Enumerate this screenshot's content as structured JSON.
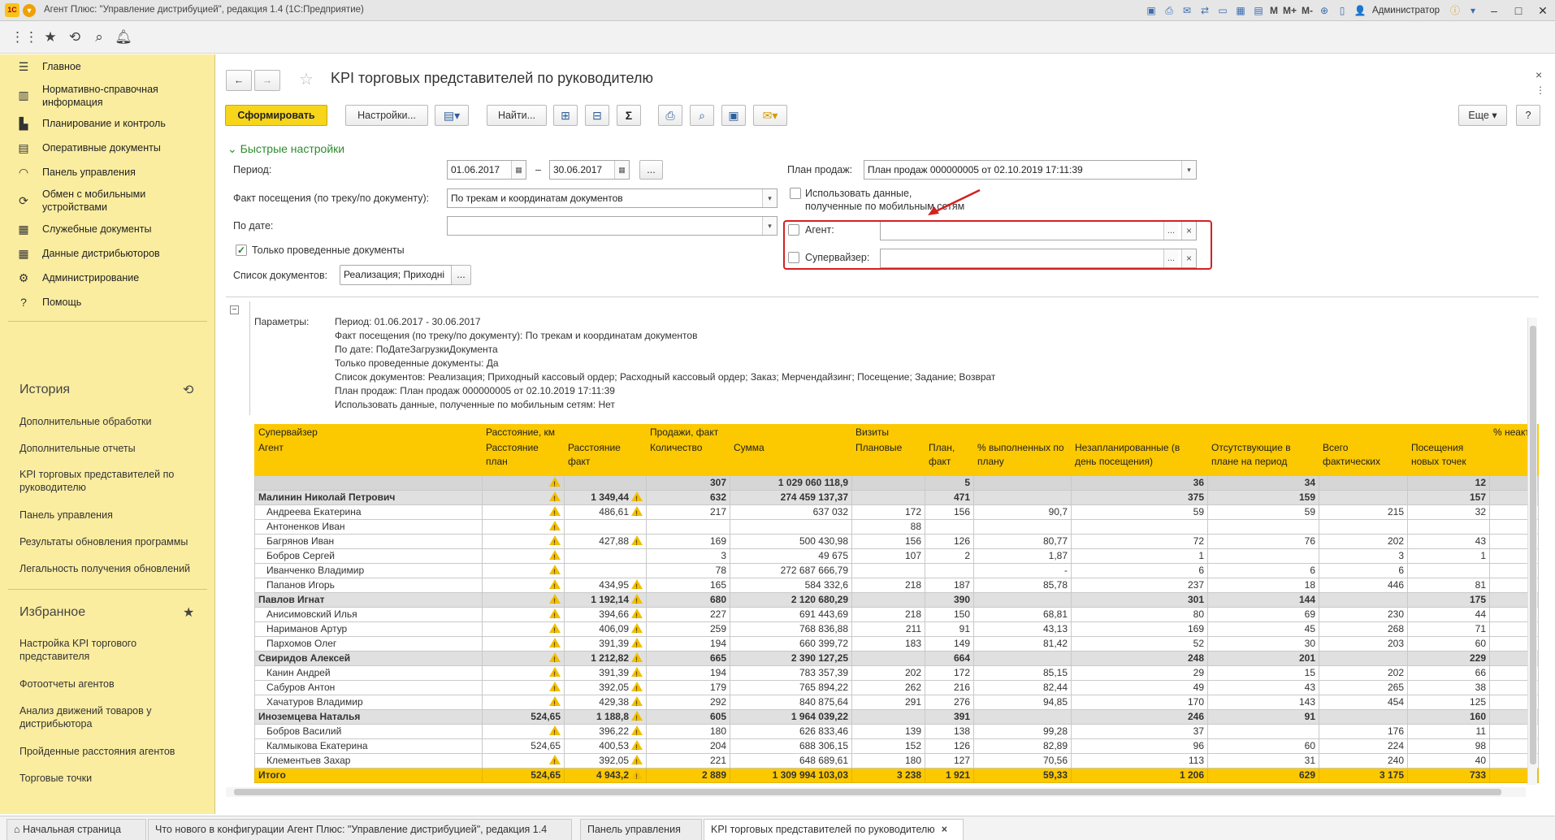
{
  "window": {
    "logo": "1С",
    "title": "Агент Плюс: \"Управление дистрибуцией\", редакция 1.4  (1С:Предприятие)",
    "user": "Администратор",
    "memory": [
      "M",
      "M+",
      "M-"
    ]
  },
  "sidebar": {
    "items": [
      {
        "label": "Главное",
        "icon": "menu-lines-icon"
      },
      {
        "label": "Нормативно-справочная информация",
        "icon": "book-icon"
      },
      {
        "label": "Планирование и контроль",
        "icon": "chart-icon"
      },
      {
        "label": "Оперативные документы",
        "icon": "documents-icon"
      },
      {
        "label": "Панель управления",
        "icon": "gauge-icon"
      },
      {
        "label": "Обмен с мобильными устройствами",
        "icon": "sync-icon"
      },
      {
        "label": "Служебные документы",
        "icon": "service-docs-icon"
      },
      {
        "label": "Данные дистрибьюторов",
        "icon": "table-icon"
      },
      {
        "label": "Администрирование",
        "icon": "gear-icon"
      },
      {
        "label": "Помощь",
        "icon": "help-icon"
      }
    ],
    "history_title": "История",
    "history": [
      "Дополнительные обработки",
      "Дополнительные отчеты",
      "KPI торговых представителей по руководителю",
      "Панель управления",
      "Результаты обновления программы",
      "Легальность получения обновлений"
    ],
    "favorites_title": "Избранное",
    "favorites": [
      "Настройка KPI торгового представителя",
      "Фотоотчеты агентов",
      "Анализ движений товаров у дистрибьютора",
      "Пройденные расстояния агентов",
      "Торговые точки"
    ]
  },
  "page": {
    "title": "KPI торговых представителей по руководителю",
    "toolbar": {
      "generate": "Сформировать",
      "settings": "Настройки...",
      "find": "Найти...",
      "sum": "Σ",
      "more": "Еще",
      "help": "?"
    },
    "quick_settings": "Быстрые настройки",
    "period_label": "Период:",
    "period_from": "01.06.2017",
    "period_dash": "–",
    "period_to": "30.06.2017",
    "fact_label": "Факт посещения (по треку/по документу):",
    "fact_value": "По трекам и координатам документов",
    "by_date_label": "По дате:",
    "by_date_value": "",
    "only_posted_label": "Только проведенные документы",
    "doc_list_label": "Список документов:",
    "doc_list_value": "Реализация; Приходні",
    "plan_label": "План продаж:",
    "plan_value": "План продаж 000000005 от 02.10.2019 17:11:39",
    "mobile_label_1": "Использовать данные,",
    "mobile_label_2": "полученные по мобильным сетям",
    "agent_label": "Агент:",
    "supervisor_label": "Супервайзер:",
    "ellipsis": "...",
    "clear": "×"
  },
  "report": {
    "params_label": "Параметры:",
    "params": [
      "Период: 01.06.2017 - 30.06.2017",
      "Факт посещения (по треку/по документу): По трекам и координатам документов",
      "По дате: ПоДатеЗагрузкиДокумента",
      "Только проведенные документы: Да",
      "Список документов: Реализация; Приходный кассовый ордер; Расходный кассовый ордер; Заказ; Мерчендайзинг; Посещение; Задание; Возврат",
      "План продаж: План продаж 000000005 от 02.10.2019 17:11:39",
      "Использовать данные, полученные по мобильным сетям: Нет"
    ],
    "header1": [
      "Супервайзер",
      "Расстояние, км",
      "Продажи, факт",
      "Визиты",
      "% неакт"
    ],
    "header2": [
      "Агент",
      "Расстояние план",
      "Расстояние факт",
      "Количество",
      "Сумма",
      "Плановые",
      "План, факт",
      "% выполненных по плану",
      "Незапланированные (в день посещения)",
      "Отсутствующие в плане на период",
      "Всего фактических",
      "Посещения новых точек",
      ""
    ],
    "rows": [
      {
        "kind": "gtop",
        "cells": [
          "",
          "",
          "",
          "307",
          "1 029 060 118,9",
          "",
          "5",
          "",
          "36",
          "34",
          "",
          "12",
          ""
        ],
        "warn": [
          1
        ]
      },
      {
        "kind": "grp",
        "cells": [
          "Малинин Николай Петрович",
          "",
          "1 349,44",
          "632",
          "274 459 137,37",
          "",
          "471",
          "",
          "375",
          "159",
          "",
          "157",
          ""
        ],
        "warn": [
          1,
          2
        ]
      },
      {
        "kind": "row",
        "cells": [
          "Андреева Екатерина",
          "",
          "486,61",
          "217",
          "637 032",
          "172",
          "156",
          "90,7",
          "59",
          "59",
          "215",
          "32",
          ""
        ],
        "warn": [
          1,
          2
        ]
      },
      {
        "kind": "row",
        "cells": [
          "Антоненков Иван",
          "",
          "",
          "",
          "",
          "88",
          "",
          "",
          "",
          "",
          "",
          "",
          ""
        ],
        "warn": [
          1
        ]
      },
      {
        "kind": "row",
        "cells": [
          "Багрянов Иван",
          "",
          "427,88",
          "169",
          "500 430,98",
          "156",
          "126",
          "80,77",
          "72",
          "76",
          "202",
          "43",
          ""
        ],
        "warn": [
          1,
          2
        ]
      },
      {
        "kind": "row",
        "cells": [
          "Бобров Сергей",
          "",
          "",
          "3",
          "49 675",
          "107",
          "2",
          "1,87",
          "1",
          "",
          "3",
          "1",
          ""
        ],
        "warn": [
          1
        ]
      },
      {
        "kind": "row",
        "cells": [
          "Иванченко Владимир",
          "",
          "",
          "78",
          "272 687 666,79",
          "",
          "",
          "-",
          "6",
          "6",
          "6",
          "",
          ""
        ],
        "warn": [
          1
        ]
      },
      {
        "kind": "row",
        "cells": [
          "Папанов Игорь",
          "",
          "434,95",
          "165",
          "584 332,6",
          "218",
          "187",
          "85,78",
          "237",
          "18",
          "446",
          "81",
          ""
        ],
        "warn": [
          1,
          2
        ]
      },
      {
        "kind": "grp",
        "cells": [
          "Павлов Игнат",
          "",
          "1 192,14",
          "680",
          "2 120 680,29",
          "",
          "390",
          "",
          "301",
          "144",
          "",
          "175",
          ""
        ],
        "warn": [
          1,
          2
        ]
      },
      {
        "kind": "row",
        "cells": [
          "Анисимовский Илья",
          "",
          "394,66",
          "227",
          "691 443,69",
          "218",
          "150",
          "68,81",
          "80",
          "69",
          "230",
          "44",
          ""
        ],
        "warn": [
          1,
          2
        ]
      },
      {
        "kind": "row",
        "cells": [
          "Нариманов Артур",
          "",
          "406,09",
          "259",
          "768 836,88",
          "211",
          "91",
          "43,13",
          "169",
          "45",
          "268",
          "71",
          ""
        ],
        "warn": [
          1,
          2
        ]
      },
      {
        "kind": "row",
        "cells": [
          "Пархомов Олег",
          "",
          "391,39",
          "194",
          "660 399,72",
          "183",
          "149",
          "81,42",
          "52",
          "30",
          "203",
          "60",
          ""
        ],
        "warn": [
          1,
          2
        ]
      },
      {
        "kind": "grp",
        "cells": [
          "Свиридов Алексей",
          "",
          "1 212,82",
          "665",
          "2 390 127,25",
          "",
          "664",
          "",
          "248",
          "201",
          "",
          "229",
          ""
        ],
        "warn": [
          1,
          2
        ]
      },
      {
        "kind": "row",
        "cells": [
          "Канин Андрей",
          "",
          "391,39",
          "194",
          "783 357,39",
          "202",
          "172",
          "85,15",
          "29",
          "15",
          "202",
          "66",
          ""
        ],
        "warn": [
          1,
          2
        ]
      },
      {
        "kind": "row",
        "cells": [
          "Сабуров Антон",
          "",
          "392,05",
          "179",
          "765 894,22",
          "262",
          "216",
          "82,44",
          "49",
          "43",
          "265",
          "38",
          ""
        ],
        "warn": [
          1,
          2
        ]
      },
      {
        "kind": "row",
        "cells": [
          "Хачатуров Владимир",
          "",
          "429,38",
          "292",
          "840 875,64",
          "291",
          "276",
          "94,85",
          "170",
          "143",
          "454",
          "125",
          ""
        ],
        "warn": [
          1,
          2
        ]
      },
      {
        "kind": "grp",
        "cells": [
          "Иноземцева Наталья",
          "524,65",
          "1 188,8",
          "605",
          "1 964 039,22",
          "",
          "391",
          "",
          "246",
          "91",
          "",
          "160",
          ""
        ],
        "warn": [
          2
        ]
      },
      {
        "kind": "row",
        "cells": [
          "Бобров Василий",
          "",
          "396,22",
          "180",
          "626 833,46",
          "139",
          "138",
          "99,28",
          "37",
          "",
          "176",
          "11",
          ""
        ],
        "warn": [
          1,
          2
        ]
      },
      {
        "kind": "row",
        "cells": [
          "Калмыкова Екатерина",
          "524,65",
          "400,53",
          "204",
          "688 306,15",
          "152",
          "126",
          "82,89",
          "96",
          "60",
          "224",
          "98",
          ""
        ],
        "warn": [
          2
        ]
      },
      {
        "kind": "row",
        "cells": [
          "Клементьев Захар",
          "",
          "392,05",
          "221",
          "648 689,61",
          "180",
          "127",
          "70,56",
          "113",
          "31",
          "240",
          "40",
          ""
        ],
        "warn": [
          1,
          2
        ]
      },
      {
        "kind": "tot",
        "cells": [
          "Итого",
          "524,65",
          "4 943,2",
          "2 889",
          "1 309 994 103,03",
          "3 238",
          "1 921",
          "59,33",
          "1 206",
          "629",
          "3 175",
          "733",
          ""
        ],
        "warn": [
          2
        ]
      }
    ]
  },
  "tabs": [
    {
      "label": "Начальная страница"
    },
    {
      "label": "Что нового в конфигурации Агент Плюс: \"Управление дистрибуцией\", редакция 1.4"
    },
    {
      "label": "Панель управления"
    },
    {
      "label": "KPI торговых представителей по руководителю"
    }
  ]
}
